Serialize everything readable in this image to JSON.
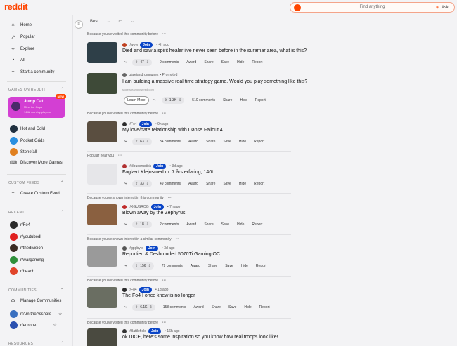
{
  "header": {
    "logo": "reddit",
    "search_placeholder": "Find anything",
    "ask": "Ask"
  },
  "sidebar": {
    "top": [
      {
        "icon": "home-icon",
        "glyph": "⌂",
        "label": "Home"
      },
      {
        "icon": "popular-icon",
        "glyph": "↗",
        "label": "Popular"
      },
      {
        "icon": "explore-icon",
        "glyph": "✧",
        "label": "Explore"
      },
      {
        "icon": "all-icon",
        "glyph": "◔",
        "label": "All"
      },
      {
        "icon": "plus-icon",
        "glyph": "+",
        "label": "Start a community"
      }
    ],
    "games": {
      "title": "GAMES ON REDDIT",
      "card": {
        "title": "Jump Cat",
        "subtitle": "Mind the Gaps",
        "players": "144k monthly players",
        "badge": "NEW"
      },
      "items": [
        "Hot and Cold",
        "Pocket Grids",
        "Stonefall",
        "Discover More Games"
      ]
    },
    "custom": {
      "title": "CUSTOM FEEDS",
      "create": "Create Custom Feed"
    },
    "recent": {
      "title": "RECENT",
      "items": [
        {
          "label": "r/Fo4",
          "color": "#2b2b2b"
        },
        {
          "label": "r/youtubedl",
          "color": "#e02020"
        },
        {
          "label": "r/thedivision",
          "color": "#3a2a22"
        },
        {
          "label": "r/wargaming",
          "color": "#2f8f3a"
        },
        {
          "label": "r/beach",
          "color": "#e0442a"
        }
      ]
    },
    "communities": {
      "title": "COMMUNITIES",
      "items": [
        {
          "label": "Manage Communities"
        },
        {
          "label": "r/AmItheAsshole",
          "color": "#3a70c0"
        },
        {
          "label": "r/europe",
          "color": "#2a50b0"
        }
      ]
    },
    "resources": {
      "title": "RESOURCES"
    }
  },
  "sort": {
    "sort_label": "Best",
    "view_label": "▭"
  },
  "feed": [
    {
      "context": "Because you've visited this community before",
      "sub": "r/wow",
      "time": "• 4h ago",
      "title": "Died and saw a spirit healer i've never seen before in the suramar area, what is this?",
      "votes": "47",
      "comments": "9 comments",
      "join": "Join",
      "thumb": "#2e3f48",
      "sav": "#c04020"
    },
    {
      "context": "",
      "sub": "u/alejandromnunez",
      "time": "• Promoted",
      "title": "I am building a massive real time strategy game. Would you play something like this?",
      "url": "store.steampowered.com",
      "learn": "Learn More",
      "votes": "1.3K",
      "comments": "510 comments",
      "thumb": "#3e4a38",
      "sav": "#666"
    },
    {
      "context": "Because you've visited this community before",
      "sub": "r/Fo4",
      "time": "• 9h ago",
      "title": "My love/hate relationship with Danse Fallout 4",
      "votes": "63",
      "comments": "34 comments",
      "join": "Join",
      "thumb": "#5a4e40",
      "sav": "#2b2b2b"
    },
    {
      "context": "Popular near you",
      "sub": "r/tilbudsrustikk",
      "time": "• 3d ago",
      "title": "Faglært Klejnsmed m. 7 års erfaring, 140t.",
      "votes": "33",
      "comments": "49 comments",
      "join": "Join",
      "thumb": "#e6e6e9",
      "sav": "#b03030"
    },
    {
      "context": "Because you've shown interest in this community",
      "sub": "r/XGUSROG",
      "time": "• 7h ago",
      "title": "Blown away by the Zephyrus",
      "votes": "18",
      "comments": "2 comments",
      "join": "Join",
      "thumb": "#8a6040",
      "sav": "#c02a2a"
    },
    {
      "context": "Because you've shown interest in a similar community",
      "sub": "r/gpgbyte",
      "time": "• 3d ago",
      "title": "Repurtied & Deshrouded 5070Ti Gaming OC",
      "votes": "156",
      "comments": "79 comments",
      "join": "Join",
      "thumb": "#9a9a9a",
      "sav": "#555"
    },
    {
      "context": "Because you've visited this community before",
      "sub": "r/Fo4",
      "time": "• 1d ago",
      "title": "The Fo4 I once knew is no longer",
      "votes": "6.1K",
      "comments": "158 comments",
      "join": "Join",
      "thumb": "#6a6e62",
      "sav": "#2b2b2b"
    },
    {
      "context": "Because you've visited this community before",
      "sub": "r/Battlefield",
      "time": "• 16h ago",
      "title": "ok DICE, here's some inspiration so you know how real troops look like!",
      "join": "Join",
      "thumb": "#4a4a40",
      "sav": "#333"
    }
  ],
  "actions": {
    "award": "Award",
    "share": "Share",
    "save": "Save",
    "hide": "Hide",
    "report": "Report"
  }
}
